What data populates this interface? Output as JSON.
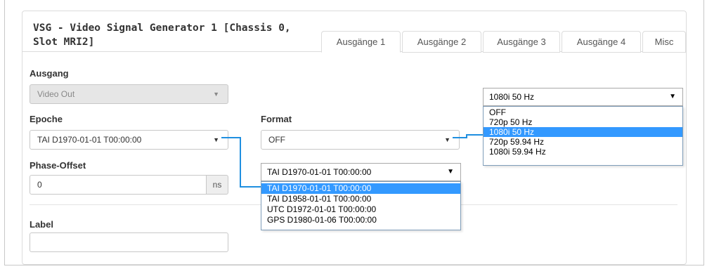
{
  "panel": {
    "title": "VSG - Video Signal Generator 1 [Chassis 0, Slot MRI2]"
  },
  "tabs": [
    {
      "label": "Ausgänge 1",
      "active": true
    },
    {
      "label": "Ausgänge 2",
      "active": false
    },
    {
      "label": "Ausgänge 3",
      "active": false
    },
    {
      "label": "Ausgänge 4",
      "active": false
    },
    {
      "label": "Misc",
      "active": false
    }
  ],
  "fields": {
    "ausgang_label": "Ausgang",
    "ausgang_value": "Video Out",
    "epoche_label": "Epoche",
    "epoche_value": "TAI D1970-01-01 T00:00:00",
    "format_label": "Format",
    "format_value": "OFF",
    "phase_label": "Phase-Offset",
    "phase_value": "0",
    "phase_unit": "ns",
    "label_label": "Label",
    "label_value": ""
  },
  "format_dropdown": {
    "selected": "1080i 50 Hz",
    "options": [
      "OFF",
      "720p 50 Hz",
      "1080i 50 Hz",
      "720p 59.94 Hz",
      "1080i 59.94 Hz"
    ],
    "highlighted_index": 2
  },
  "epoche_dropdown": {
    "selected": "TAI D1970-01-01 T00:00:00",
    "options": [
      "TAI D1970-01-01 T00:00:00",
      "TAI D1958-01-01 T00:00:00",
      "UTC D1972-01-01 T00:00:00",
      "GPS D1980-01-06 T00:00:00"
    ],
    "highlighted_index": 0
  },
  "colors": {
    "highlight": "#3399ff",
    "connector": "#1f8fe0"
  },
  "icons": {
    "caret": "caret-down-icon"
  }
}
